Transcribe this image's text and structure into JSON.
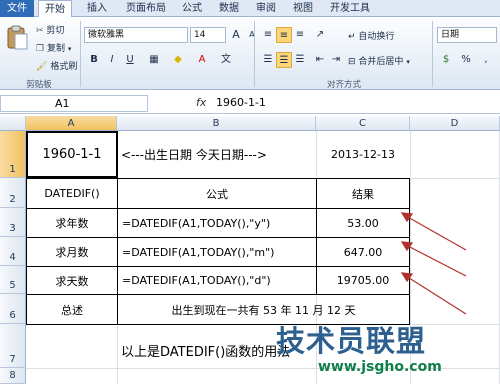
{
  "ribbon_tabs": [
    "文件",
    "开始",
    "插入",
    "页面布局",
    "公式",
    "数据",
    "审阅",
    "视图",
    "开发工具"
  ],
  "clipboard": {
    "cut": "剪切",
    "copy": "复制",
    "format_painter": "格式刷",
    "group": "剪贴板"
  },
  "font": {
    "name": "微软雅黑",
    "size": "14"
  },
  "alignment": {
    "wrap": "自动换行",
    "merge": "合并后居中",
    "group": "对齐方式"
  },
  "number": {
    "format": "日期"
  },
  "formula_bar": {
    "name_box": "A1",
    "fx": "fx",
    "content": "1960-1-1"
  },
  "columns": [
    "A",
    "B",
    "C",
    "D"
  ],
  "rows": [
    "1",
    "2",
    "3",
    "4",
    "5",
    "6",
    "7",
    "8"
  ],
  "cells": {
    "a1": "1960-1-1",
    "b1": "<---出生日期    今天日期--->",
    "c1": "2013-12-13",
    "a2": "DATEDIF()",
    "b2": "公式",
    "c2": "结果",
    "a3": "求年数",
    "b3": "=DATEDIF(A1,TODAY(),\"y\")",
    "c3": "53.00",
    "a4": "求月数",
    "b4": "=DATEDIF(A1,TODAY(),\"m\")",
    "c4": "647.00",
    "a5": "求天数",
    "b5": "=DATEDIF(A1,TODAY(),\"d\")",
    "c5": "19705.00",
    "a6": "总述",
    "b6": "出生到现在一共有 53 年 11 月 12 天",
    "b7": "以上是DATEDIF()函数的用法"
  },
  "watermark": {
    "brand": "技术员联盟",
    "url": "www.jsgho.com"
  },
  "colors": {
    "file_tab": "#2f6cb8",
    "selection_header": "#f1c15f",
    "arrow": "#b0302b"
  }
}
